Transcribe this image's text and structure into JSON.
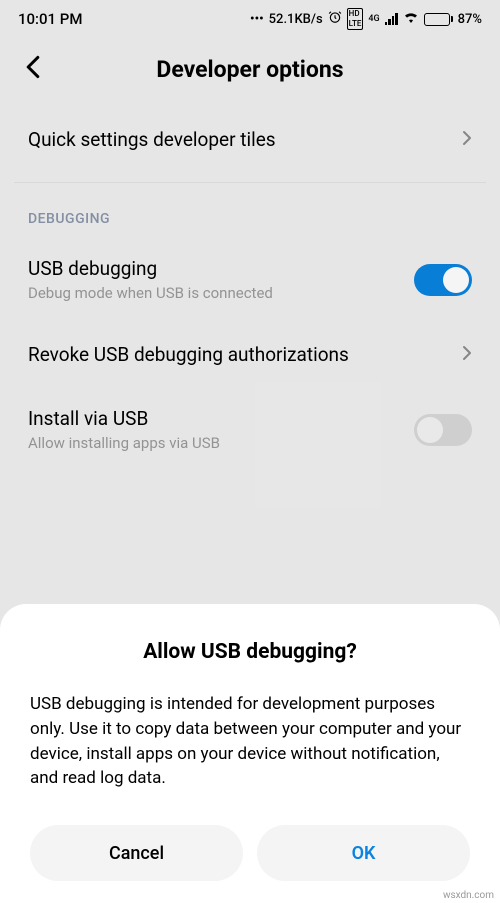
{
  "statusbar": {
    "time": "10:01 PM",
    "dots": "•••",
    "speed": "52.1KB/s",
    "battery_percent": "87%"
  },
  "header": {
    "title": "Developer options"
  },
  "rows": {
    "quick_tiles": {
      "title": "Quick settings developer tiles"
    },
    "usb_debugging": {
      "title": "USB debugging",
      "subtitle": "Debug mode when USB is connected"
    },
    "revoke": {
      "title": "Revoke USB debugging authorizations"
    },
    "install_usb": {
      "title": "Install via USB",
      "subtitle": "Allow installing apps via USB"
    }
  },
  "section": {
    "debugging": "DEBUGGING"
  },
  "dialog": {
    "title": "Allow USB debugging?",
    "body": "USB debugging is intended for development purposes only. Use it to copy data between your computer and your device, install apps on your device without notification, and read log data.",
    "cancel": "Cancel",
    "ok": "OK"
  },
  "watermark": "wsxdn.com"
}
